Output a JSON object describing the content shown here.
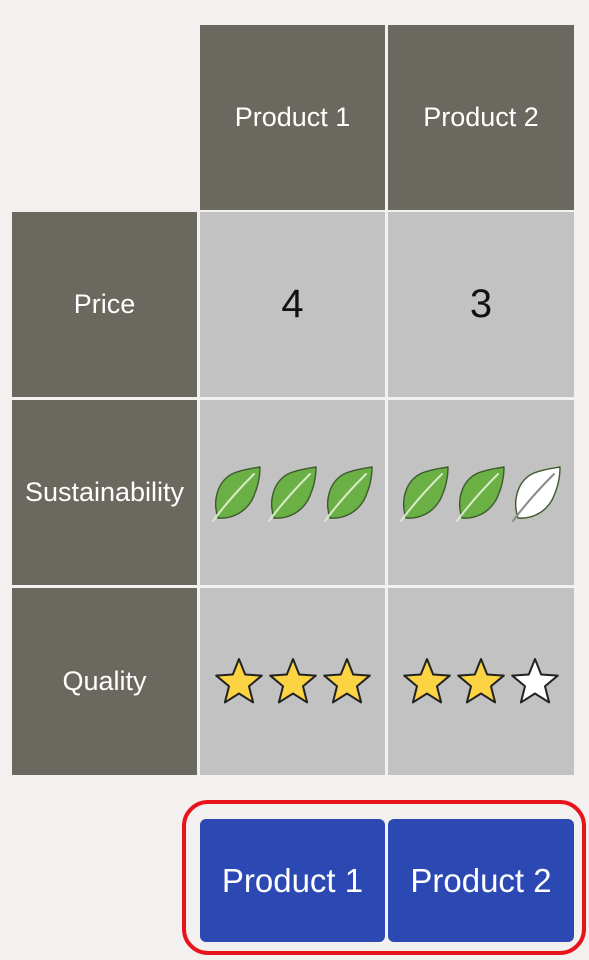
{
  "columns": [
    {
      "label": "Product 1"
    },
    {
      "label": "Product 2"
    }
  ],
  "rows": {
    "price": {
      "label": "Price",
      "values": [
        "4",
        "3"
      ]
    },
    "sustainability": {
      "label": "Sustainability",
      "icon": "leaf-icon",
      "max": 3,
      "ratings": [
        3,
        2
      ],
      "filled_color": "#6ab045",
      "empty_color": "#ffffff"
    },
    "quality": {
      "label": "Quality",
      "icon": "star-icon",
      "max": 3,
      "ratings": [
        3,
        2
      ],
      "filled_color": "#fbd343",
      "empty_color": "#ffffff"
    }
  },
  "choice": {
    "buttons": [
      {
        "label": "Product 1"
      },
      {
        "label": "Product 2"
      }
    ],
    "button_color": "#2c49b3",
    "highlight_color": "#e8141c"
  }
}
